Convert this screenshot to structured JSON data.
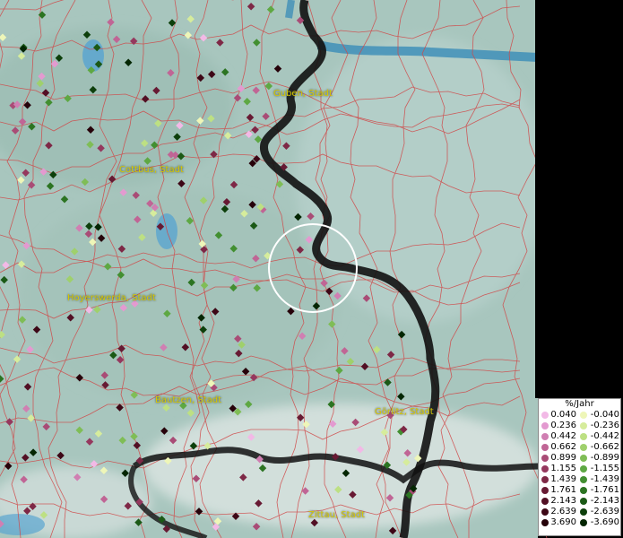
{
  "map": {
    "cities": [
      {
        "name": "Guben, Stadt"
      },
      {
        "name": "Cottbus, Stadt"
      },
      {
        "name": "Hoyerswerda, Stadt"
      },
      {
        "name": "Bautzen, Stadt"
      },
      {
        "name": "Görlitz, Stadt"
      },
      {
        "name": "Zittau, Stadt"
      }
    ]
  },
  "legend": {
    "title": "%/Jahr",
    "positive": [
      {
        "value": "0.040",
        "color": "#f2b9e6"
      },
      {
        "value": "0.236",
        "color": "#e39ad0"
      },
      {
        "value": "0.442",
        "color": "#d07fb2"
      },
      {
        "value": "0.662",
        "color": "#c06595"
      },
      {
        "value": "0.899",
        "color": "#a94c76"
      },
      {
        "value": "1.155",
        "color": "#95385e"
      },
      {
        "value": "1.439",
        "color": "#7e2846"
      },
      {
        "value": "1.761",
        "color": "#671a33"
      },
      {
        "value": "2.143",
        "color": "#520f24"
      },
      {
        "value": "2.639",
        "color": "#3d0716"
      },
      {
        "value": "3.690",
        "color": "#26020a"
      }
    ],
    "negative": [
      {
        "value": "-0.040",
        "color": "#eef6b8"
      },
      {
        "value": "-0.236",
        "color": "#d6ec9c"
      },
      {
        "value": "-0.442",
        "color": "#bde083"
      },
      {
        "value": "-0.662",
        "color": "#9fd06c"
      },
      {
        "value": "-0.899",
        "color": "#7fbd56"
      },
      {
        "value": "-1.155",
        "color": "#5ea843"
      },
      {
        "value": "-1.439",
        "color": "#428f31"
      },
      {
        "value": "-1.761",
        "color": "#2c7422"
      },
      {
        "value": "-2.143",
        "color": "#1b5916"
      },
      {
        "value": "-2.639",
        "color": "#0d3f0b"
      },
      {
        "value": "-3.690",
        "color": "#042603"
      }
    ]
  }
}
